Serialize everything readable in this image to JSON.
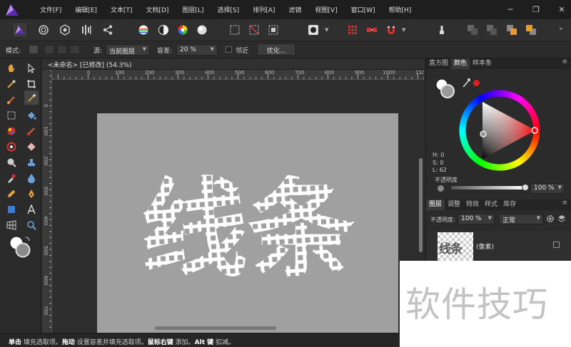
{
  "menu": {
    "items": [
      "文件[F]",
      "编辑[E]",
      "文本[T]",
      "文档[D]",
      "图层[L]",
      "选择[S]",
      "排列[A]",
      "滤镜",
      "视图[V]",
      "窗口[W]",
      "帮助[H]"
    ],
    "controls": [
      "─",
      "❐",
      "✕"
    ]
  },
  "context": {
    "mode_label": "模式:",
    "source_label": "源:",
    "source_value": "当前图层",
    "tolerance_label": "容差:",
    "tolerance_value": "20 %",
    "contiguous_label": "邻近",
    "refine_label": "优化..."
  },
  "document": {
    "tab_title": "<未命名> [已修改] (54.3%)",
    "ruler_h": [
      "0",
      "100",
      "200",
      "300",
      "400",
      "500",
      "600",
      "700",
      "800",
      "900",
      "1000",
      "110"
    ],
    "ruler_v": [
      "0",
      "100",
      "200",
      "300",
      "400",
      "500",
      "600",
      "700"
    ],
    "artwork_text": "线条"
  },
  "panels": {
    "color_tabs": [
      "直方图",
      "颜色",
      "样本条"
    ],
    "color_active_tab": "颜色",
    "hsl": {
      "h": "H: 0",
      "s": "S: 0",
      "l": "L: 62"
    },
    "opacity_label": "不透明度",
    "opacity_value": "100 %",
    "layer_tabs": [
      "图层",
      "调整",
      "特效",
      "样式",
      "库存"
    ],
    "layer_active_tab": "图层",
    "layer_opacity_label": "不透明度:",
    "layer_opacity_value": "100 %",
    "blend_mode": "正常",
    "layer_name": "(像素)",
    "layer_thumb_text": "线条"
  },
  "status": {
    "segments": [
      {
        "bold": true,
        "text": "单击"
      },
      {
        "bold": false,
        "text": " 填充选取项。"
      },
      {
        "bold": true,
        "text": "拖动"
      },
      {
        "bold": false,
        "text": " 设置容差并填充选取项。"
      },
      {
        "bold": true,
        "text": "鼠标右键"
      },
      {
        "bold": false,
        "text": " 添加。"
      },
      {
        "bold": true,
        "text": "Alt 键"
      },
      {
        "bold": false,
        "text": " 扣减。"
      }
    ]
  },
  "watermark": {
    "text": "软件技巧"
  },
  "colors": {
    "accent_red": "#e02020",
    "canvas_gray": "#a0a0a0",
    "brand_purple": "#8a4fd8"
  }
}
